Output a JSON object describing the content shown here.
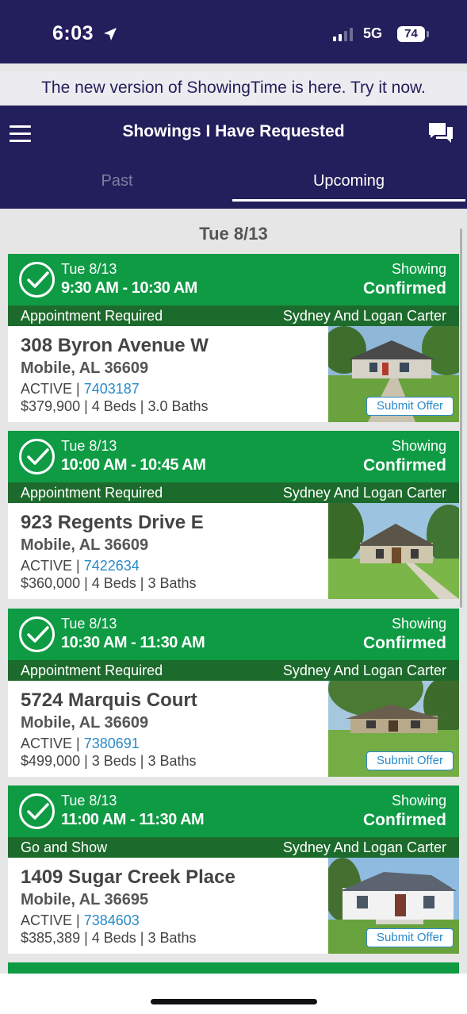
{
  "status_bar": {
    "time": "6:03",
    "network": "5G",
    "battery": "74"
  },
  "promo_banner": "The new version of ShowingTime is here. Try it now.",
  "header": {
    "title": "Showings I Have Requested",
    "tabs": [
      {
        "label": "Past",
        "selected": false
      },
      {
        "label": "Upcoming",
        "selected": true
      }
    ]
  },
  "date_heading": "Tue 8/13",
  "showings": [
    {
      "date": "Tue 8/13",
      "time": "9:30 AM - 10:30 AM",
      "status_line1": "Showing",
      "status_line2": "Confirmed",
      "requirement": "Appointment Required",
      "agent": "Sydney And Logan Carter",
      "address": "308 Byron Avenue W",
      "city": "Mobile, AL 36609",
      "listing_status": "ACTIVE",
      "mls": "7403187",
      "details": "$379,900 | 4 Beds | 3.0 Baths",
      "offer_button": "Submit Offer"
    },
    {
      "date": "Tue 8/13",
      "time": "10:00 AM - 10:45 AM",
      "status_line1": "Showing",
      "status_line2": "Confirmed",
      "requirement": "Appointment Required",
      "agent": "Sydney And Logan Carter",
      "address": "923 Regents Drive E",
      "city": "Mobile, AL 36609",
      "listing_status": "ACTIVE",
      "mls": "7422634",
      "details": "$360,000 | 4 Beds | 3 Baths",
      "offer_button": ""
    },
    {
      "date": "Tue 8/13",
      "time": "10:30 AM - 11:30 AM",
      "status_line1": "Showing",
      "status_line2": "Confirmed",
      "requirement": "Appointment Required",
      "agent": "Sydney And Logan Carter",
      "address": "5724 Marquis Court",
      "city": "Mobile, AL 36609",
      "listing_status": "ACTIVE",
      "mls": "7380691",
      "details": "$499,000 | 3 Beds | 3 Baths",
      "offer_button": "Submit Offer"
    },
    {
      "date": "Tue 8/13",
      "time": "11:00 AM - 11:30 AM",
      "status_line1": "Showing",
      "status_line2": "Confirmed",
      "requirement": "Go and Show",
      "agent": "Sydney And Logan Carter",
      "address": "1409 Sugar Creek Place",
      "city": "Mobile, AL 36695",
      "listing_status": "ACTIVE",
      "mls": "7384603",
      "details": "$385,389 | 4 Beds | 3 Baths",
      "offer_button": "Submit Offer"
    }
  ],
  "colors": {
    "navy": "#231f5c",
    "green": "#0e9b44",
    "dark_green": "#1d6b2c",
    "link_blue": "#2a8ac8"
  }
}
